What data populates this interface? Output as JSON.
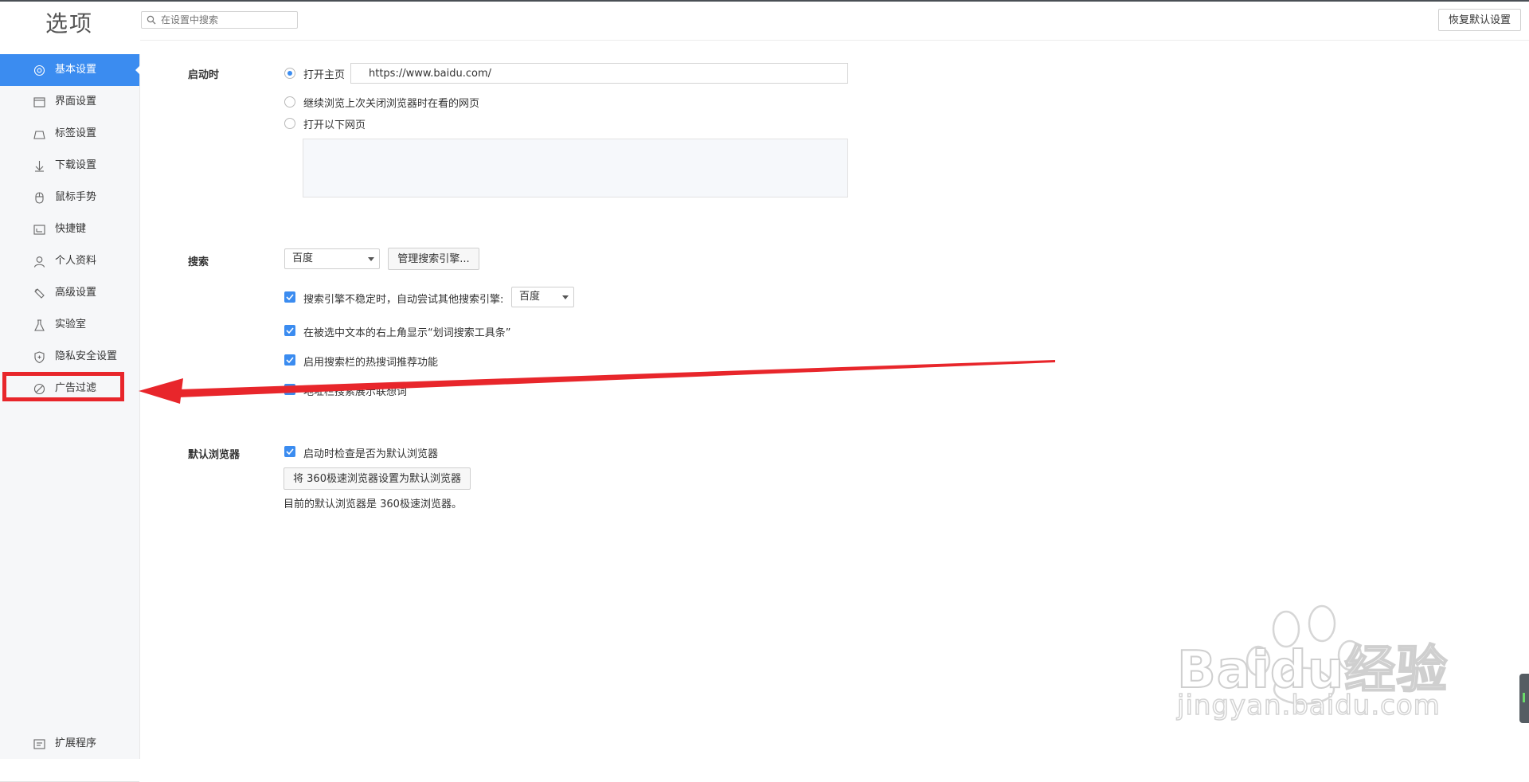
{
  "header": {
    "title": "选项",
    "search_placeholder": "在设置中搜索",
    "restore_label": "恢复默认设置"
  },
  "sidebar": {
    "items": [
      {
        "label": "基本设置",
        "icon": "gear-icon",
        "active": true
      },
      {
        "label": "界面设置",
        "icon": "window-icon"
      },
      {
        "label": "标签设置",
        "icon": "tab-icon"
      },
      {
        "label": "下载设置",
        "icon": "download-icon"
      },
      {
        "label": "鼠标手势",
        "icon": "mouse-icon"
      },
      {
        "label": "快捷键",
        "icon": "keyboard-icon"
      },
      {
        "label": "个人资料",
        "icon": "user-icon"
      },
      {
        "label": "高级设置",
        "icon": "wrench-icon"
      },
      {
        "label": "实验室",
        "icon": "flask-icon"
      },
      {
        "label": "隐私安全设置",
        "icon": "shield-icon"
      },
      {
        "label": "广告过滤",
        "icon": "block-icon"
      }
    ],
    "extensions_label": "扩展程序",
    "extensions_icon": "extensions-icon"
  },
  "startup": {
    "label": "启动时",
    "option_homepage": "打开主页",
    "homepage_url": "https://www.baidu.com/",
    "option_continue": "继续浏览上次关闭浏览器时在看的网页",
    "option_pages": "打开以下网页",
    "selected": "homepage"
  },
  "search": {
    "label": "搜索",
    "engine": "百度",
    "manage_label": "管理搜索引擎...",
    "fallback_label": "搜索引擎不稳定时，自动尝试其他搜索引擎:",
    "fallback_engine": "百度",
    "toolbar_label": "在被选中文本的右上角显示“划词搜索工具条”",
    "hotwords_label": "启用搜索栏的热搜词推荐功能",
    "suggest_label": "地址栏搜索展示联想词"
  },
  "default_browser": {
    "label": "默认浏览器",
    "check_label": "启动时检查是否为默认浏览器",
    "set_button": "将 360极速浏览器设置为默认浏览器",
    "status": "目前的默认浏览器是 360极速浏览器。"
  },
  "watermark": {
    "brand": "Baidu经验",
    "url": "jingyan.baidu.com"
  },
  "colors": {
    "accent": "#3b8cf0",
    "annotation": "#e8262b",
    "sidebar_bg": "#f6f7f9"
  }
}
